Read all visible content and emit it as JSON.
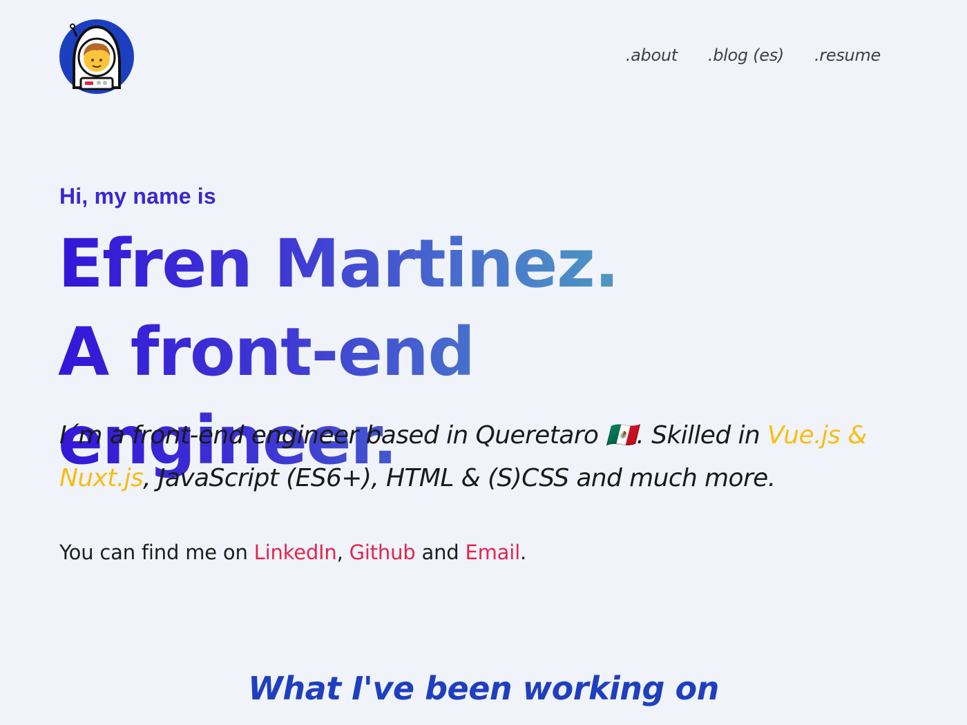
{
  "header": {
    "logo_icon": "astronaut-icon",
    "nav": [
      {
        "label": ".about"
      },
      {
        "label": ".blog (es)"
      },
      {
        "label": ".resume"
      }
    ]
  },
  "hero": {
    "greeting": "Hi, my name is",
    "name_line": "Efren Martinez.",
    "title_line": "A front-end engineer.",
    "intro_part1": "I´m a front-end engineer based in Queretaro ",
    "intro_flag": "🇲🇽",
    "intro_part2": ". Skilled in ",
    "intro_accent": "Vue.js & Nuxt.js",
    "intro_part3": ", JavaScript (ES6+), HTML & (S)CSS and much more.",
    "find_prefix": "You can find me on ",
    "link_linkedin": "LinkedIn",
    "sep_comma": ", ",
    "link_github": "Github",
    "sep_and": " and ",
    "link_email": "Email",
    "find_suffix": "."
  },
  "section": {
    "working_title": "What I've been working on"
  },
  "colors": {
    "background": "#f0f3f9",
    "gradient_start": "#3416d8",
    "gradient_end": "#56c6b4",
    "accent_yellow": "#f7be12",
    "link_red": "#e2264f",
    "section_blue": "#1f3fbf"
  }
}
